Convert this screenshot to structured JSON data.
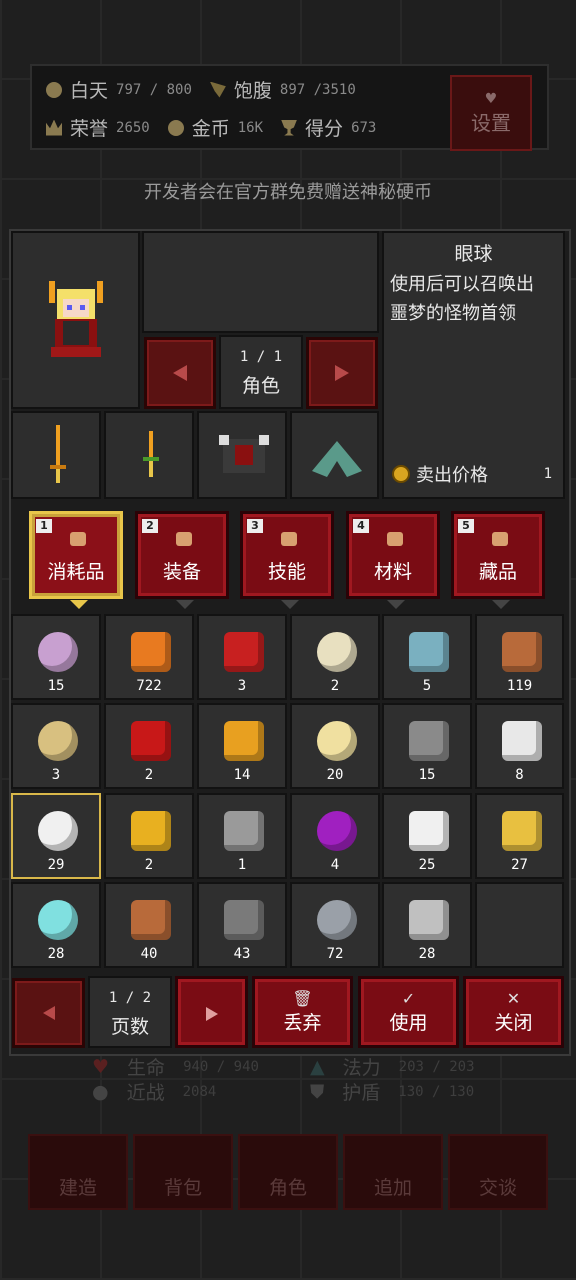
{
  "hud": {
    "day_label": "白天",
    "day_value": "797 / 800",
    "food_label": "饱腹",
    "food_value": "897 /3510",
    "honor_label": "荣誉",
    "honor_value": "2650",
    "gold_label": "金币",
    "gold_value": "16K",
    "score_label": "得分",
    "score_value": "673"
  },
  "settings_label": "设置",
  "banner": "开发者会在官方群免费赠送神秘硬币",
  "character": {
    "page": "1 / 1",
    "page_label": "角色"
  },
  "description": {
    "title": "眼球",
    "body_line1": "使用后可以召唤出",
    "body_line2": "噩梦的怪物首领",
    "sell_label": "卖出价格",
    "sell_value": "1"
  },
  "tabs": [
    {
      "key": "1",
      "label": "消耗品",
      "active": true
    },
    {
      "key": "2",
      "label": "装备",
      "active": false
    },
    {
      "key": "3",
      "label": "技能",
      "active": false
    },
    {
      "key": "4",
      "label": "材料",
      "active": false
    },
    {
      "key": "5",
      "label": "藏品",
      "active": false
    }
  ],
  "items": [
    {
      "icon": "turnip-icon",
      "count": "15"
    },
    {
      "icon": "pumpkin-icon",
      "count": "722"
    },
    {
      "icon": "cherry-icon",
      "count": "3"
    },
    {
      "icon": "scroll-icon",
      "count": "2"
    },
    {
      "icon": "fish-icon",
      "count": "5"
    },
    {
      "icon": "fried-fish-icon",
      "count": "119"
    },
    {
      "icon": "oil-jar-icon",
      "count": "3"
    },
    {
      "icon": "red-potion-icon",
      "count": "2"
    },
    {
      "icon": "medal-icon",
      "count": "14"
    },
    {
      "icon": "jar-icon",
      "count": "20"
    },
    {
      "icon": "cloth-roll-icon",
      "count": "15"
    },
    {
      "icon": "bone-icon",
      "count": "8"
    },
    {
      "icon": "eyeball-icon",
      "count": "29"
    },
    {
      "icon": "crown-icon",
      "count": "2"
    },
    {
      "icon": "robot-icon",
      "count": "1"
    },
    {
      "icon": "purple-potion-icon",
      "count": "4"
    },
    {
      "icon": "angel-statue-icon",
      "count": "25"
    },
    {
      "icon": "gold-statue-icon",
      "count": "27"
    },
    {
      "icon": "crystal-statue-icon",
      "count": "28"
    },
    {
      "icon": "tree-statue-icon",
      "count": "40"
    },
    {
      "icon": "bat-statue-icon",
      "count": "43"
    },
    {
      "icon": "totem-statue-icon",
      "count": "72"
    },
    {
      "icon": "target-icon",
      "count": "28"
    },
    {
      "icon": "empty-slot",
      "count": ""
    }
  ],
  "pager": {
    "value": "1 / 2",
    "label": "页数"
  },
  "actions": {
    "discard": "丢弃",
    "use": "使用",
    "close": "关闭"
  },
  "stats": {
    "hp_label": "生命",
    "hp_value": "940 / 940",
    "mp_label": "法力",
    "mp_value": "203 / 203",
    "melee_label": "近战",
    "melee_value": "2084",
    "shield_label": "护盾",
    "shield_value": "130 / 130"
  },
  "bottom_nav": [
    "建造",
    "背包",
    "角色",
    "追加",
    "交谈"
  ],
  "colors": {
    "accent_red": "#7a0c14",
    "highlight_gold": "#e8c64a"
  }
}
